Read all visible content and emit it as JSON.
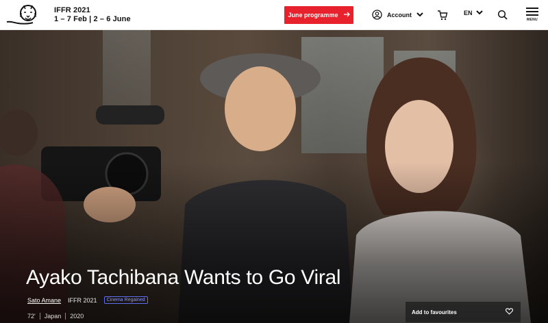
{
  "header": {
    "festival_name": "IFFR 2021",
    "festival_dates": "1 – 7 Feb | 2 – 6 June",
    "programme_button": "June programme",
    "account_label": "Account",
    "language": "EN",
    "menu_label": "MENU"
  },
  "colors": {
    "accent": "#e8222c",
    "badge": "#5f6ef2"
  },
  "hero": {
    "title": "Ayako Tachibana Wants to Go Viral",
    "director": "Sato Amane",
    "edition": "IFFR 2021",
    "section_badge": "Cinema Regained",
    "duration": "72'",
    "country": "Japan",
    "year": "2020",
    "favourite_button": "Add to favourites"
  },
  "icons": {
    "logo": "tiger-logo-icon",
    "arrow": "arrow-right-icon",
    "account": "user-circle-icon",
    "cart": "cart-icon",
    "search": "search-icon",
    "heart": "heart-icon"
  }
}
